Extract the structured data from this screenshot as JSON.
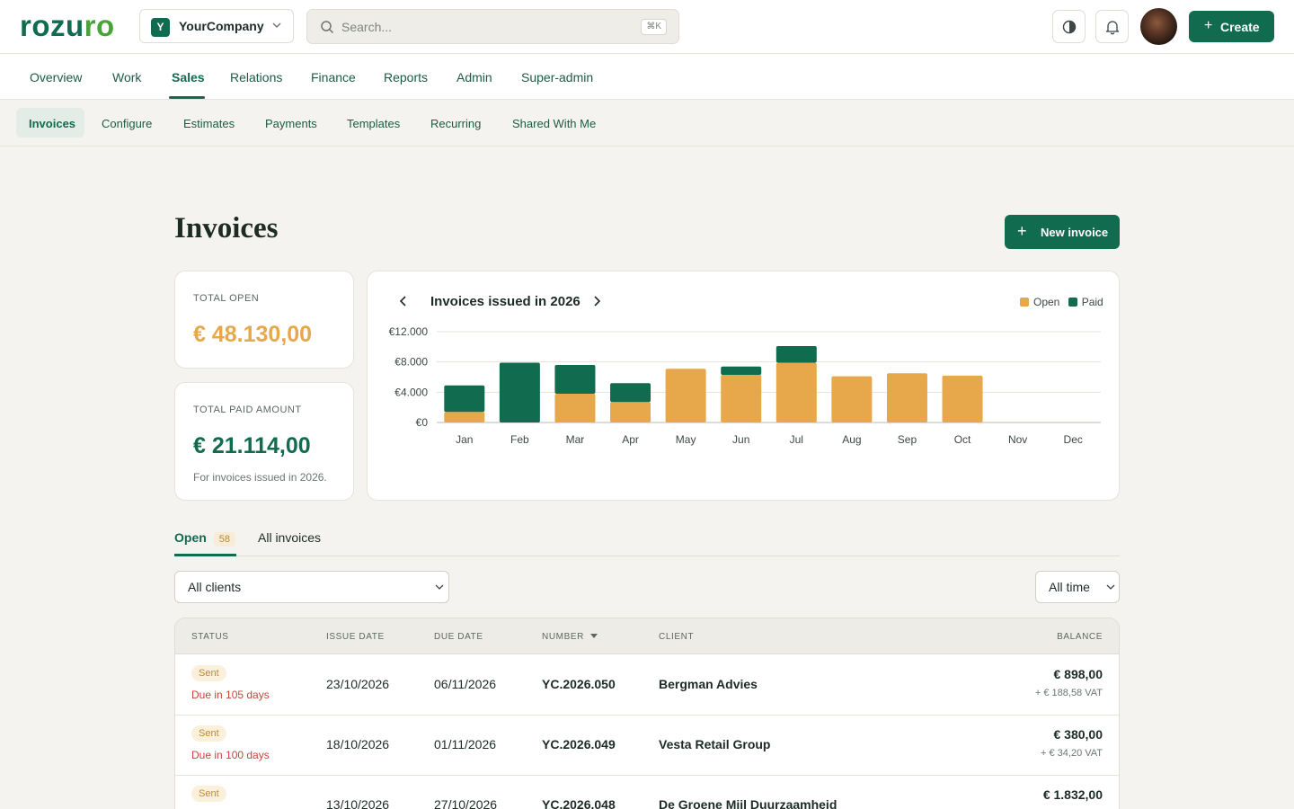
{
  "brand": {
    "logo_part1": "rozu",
    "logo_part2": "ro"
  },
  "company": {
    "initial": "Y",
    "name": "YourCompany"
  },
  "search": {
    "placeholder": "Search...",
    "shortcut": "⌘K"
  },
  "header": {
    "create_label": "Create"
  },
  "main_nav": [
    {
      "label": "Overview"
    },
    {
      "label": "Work"
    },
    {
      "label": "Sales",
      "active": true
    },
    {
      "label": "Relations"
    },
    {
      "label": "Finance"
    },
    {
      "label": "Reports"
    },
    {
      "label": "Admin"
    },
    {
      "label": "Super-admin"
    }
  ],
  "sub_nav": [
    {
      "label": "Invoices",
      "active": true
    },
    {
      "label": "Configure"
    },
    {
      "label": "Estimates"
    },
    {
      "label": "Payments"
    },
    {
      "label": "Templates"
    },
    {
      "label": "Recurring"
    },
    {
      "label": "Shared With Me"
    }
  ],
  "page": {
    "title": "Invoices",
    "new_button": "New invoice"
  },
  "summary": {
    "total_open_label": "TOTAL OPEN",
    "total_open_value": "€ 48.130,00",
    "total_paid_label": "TOTAL PAID AMOUNT",
    "total_paid_value": "€ 21.114,00",
    "note": "For invoices issued in 2026."
  },
  "colors": {
    "primary": "#116b4f",
    "open": "#e6a84a",
    "paid": "#116b4f"
  },
  "chart_data": {
    "type": "bar",
    "stacked": true,
    "title": "Invoices issued in 2026",
    "categories": [
      "Jan",
      "Feb",
      "Mar",
      "Apr",
      "May",
      "Jun",
      "Jul",
      "Aug",
      "Sep",
      "Oct",
      "Nov",
      "Dec"
    ],
    "series": [
      {
        "name": "Open",
        "color": "#e6a84a",
        "values": [
          1400,
          0,
          3800,
          2700,
          7100,
          6300,
          7900,
          6100,
          6500,
          6200,
          0,
          0
        ]
      },
      {
        "name": "Paid",
        "color": "#116b4f",
        "values": [
          3500,
          7900,
          3800,
          2500,
          0,
          1100,
          2200,
          0,
          0,
          0,
          0,
          0
        ]
      }
    ],
    "y_ticks": [
      "€0",
      "€4.000",
      "€8.000",
      "€12.000"
    ],
    "ylim": [
      0,
      12000
    ],
    "legend": "top-right",
    "grid": true
  },
  "tabs": {
    "open_label": "Open",
    "open_count": "58",
    "all_label": "All invoices"
  },
  "filters": {
    "clients": "All clients",
    "period": "All time"
  },
  "table": {
    "headers": {
      "status": "STATUS",
      "issue": "ISSUE DATE",
      "due": "DUE DATE",
      "number": "NUMBER",
      "client": "CLIENT",
      "balance": "BALANCE"
    },
    "rows": [
      {
        "status": "Sent",
        "due_text": "Due in 105 days",
        "issue": "23/10/2026",
        "due": "06/11/2026",
        "number": "YC.2026.050",
        "client": "Bergman Advies",
        "balance": "€ 898,00",
        "vat": "+ € 188,58 VAT"
      },
      {
        "status": "Sent",
        "due_text": "Due in 100 days",
        "issue": "18/10/2026",
        "due": "01/11/2026",
        "number": "YC.2026.049",
        "client": "Vesta Retail Group",
        "balance": "€ 380,00",
        "vat": "+ € 34,20 VAT"
      },
      {
        "status": "Sent",
        "due_text": "",
        "issue": "13/10/2026",
        "due": "27/10/2026",
        "number": "YC.2026.048",
        "client": "De Groene Mijl Duurzaamheid",
        "balance": "€ 1.832,00",
        "vat": ""
      }
    ]
  }
}
